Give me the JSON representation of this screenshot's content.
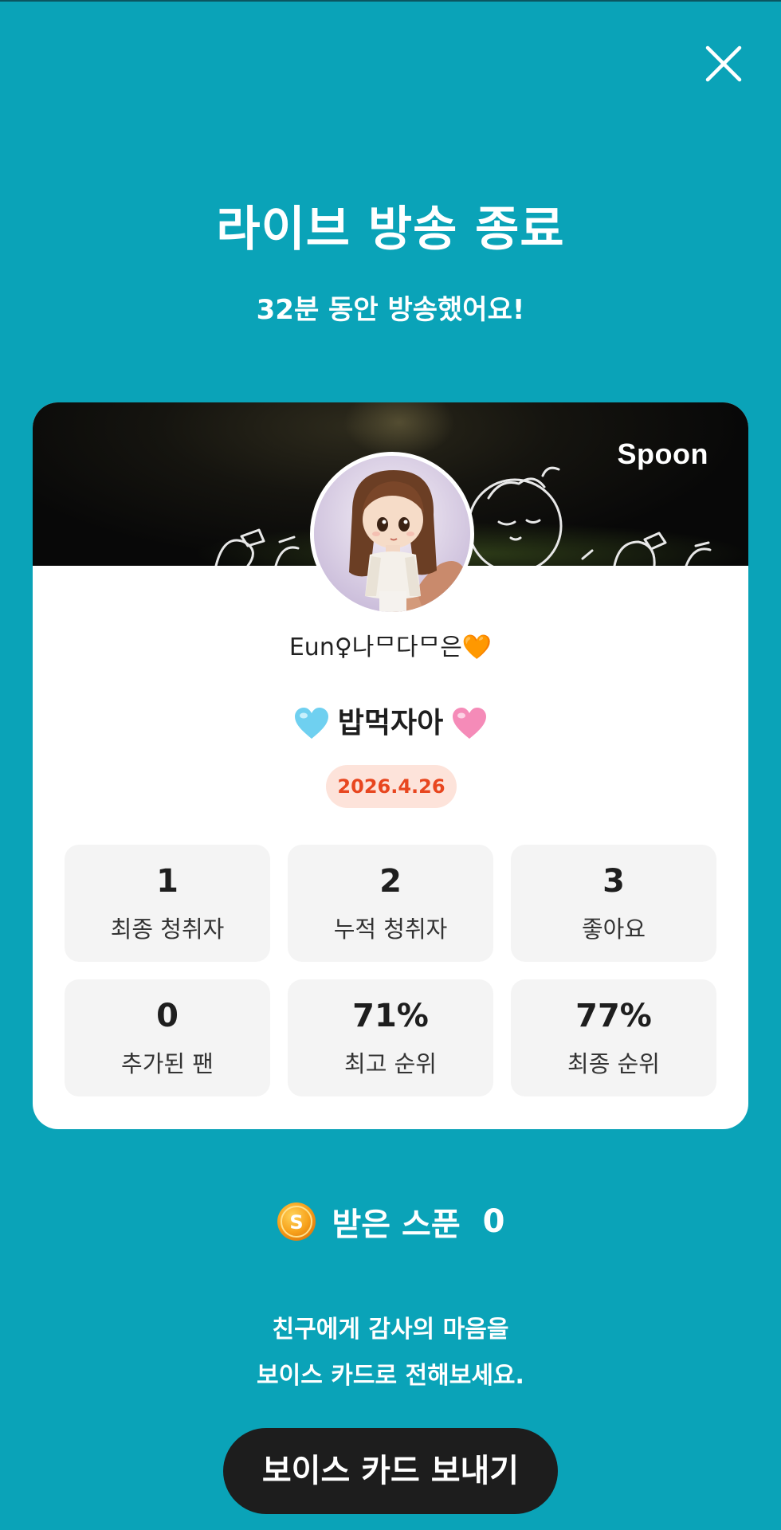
{
  "header": {
    "title": "라이브 방송 종료",
    "subtitle": "32분 동안 방송했어요!",
    "close_icon": "close-icon"
  },
  "card": {
    "brand": "Spoon",
    "username": "Eun♀나ᄆ다ᄆ은🧡",
    "stream_title": "밥먹자아",
    "title_icons": [
      "blue-heart-icon",
      "pink-heart-icon"
    ],
    "date": "2026.4.26",
    "stats": [
      {
        "value": "1",
        "label": "최종 청취자"
      },
      {
        "value": "2",
        "label": "누적 청취자"
      },
      {
        "value": "3",
        "label": "좋아요"
      },
      {
        "value": "0",
        "label": "추가된 팬"
      },
      {
        "value": "71%",
        "label": "최고 순위"
      },
      {
        "value": "77%",
        "label": "최종 순위"
      }
    ]
  },
  "spoons": {
    "label": "받은 스푼",
    "count": "0",
    "icon": "spoon-coin-icon"
  },
  "thanks": {
    "line1": "친구에게 감사의 마음을",
    "line2": "보이스 카드로 전해보세요."
  },
  "send_button": {
    "label": "보이스 카드 보내기"
  },
  "colors": {
    "background": "#0aa3b8",
    "button": "#1d1d1d",
    "date_text": "#e8461f",
    "date_bg": "#fde3da"
  }
}
